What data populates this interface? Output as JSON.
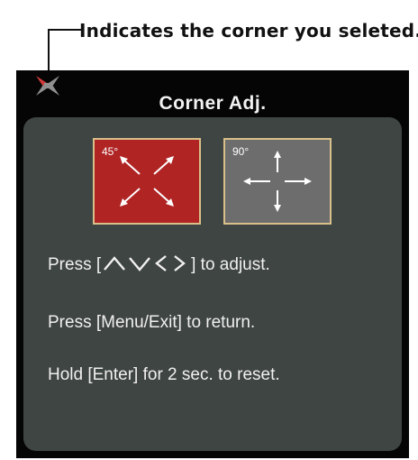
{
  "callout": {
    "text": "Indicates the corner you seleted."
  },
  "osd": {
    "title": "Corner Adj.",
    "modes": [
      {
        "degree": "45°",
        "selected": true,
        "icon": "diagonal-arrows-icon"
      },
      {
        "degree": "90°",
        "selected": false,
        "icon": "cross-arrows-icon"
      }
    ],
    "instructions": {
      "adjust_prefix": "Press [",
      "adjust_suffix": "] to adjust.",
      "return": "Press [Menu/Exit] to return.",
      "reset": "Hold [Enter] for 2 sec. to reset."
    }
  },
  "colors": {
    "selected_mode": "#b02424",
    "unselected_mode": "#6d6d6d",
    "panel": "#3f4543",
    "frame": "#d9c08a"
  }
}
